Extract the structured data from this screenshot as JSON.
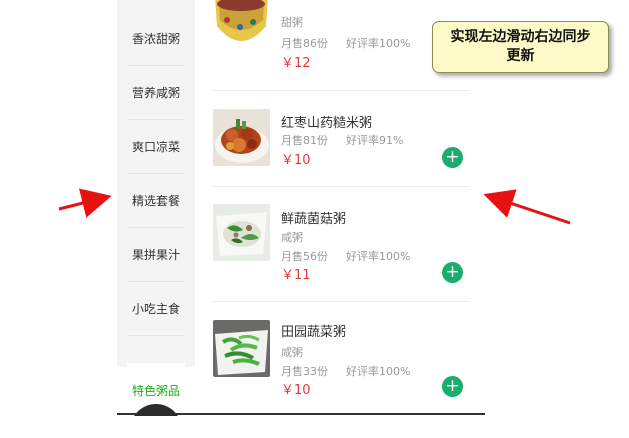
{
  "sidebar": {
    "categories": [
      "香浓甜粥",
      "营养咸粥",
      "爽口凉菜",
      "精选套餐",
      "果拼果汁",
      "小吃主食"
    ],
    "active_category": "特色粥品"
  },
  "products": [
    {
      "subtitle": "甜粥",
      "sales": "月售86份",
      "rating": "好评率100%",
      "price": "￥12"
    },
    {
      "name": "红枣山药糙米粥",
      "sales": "月售81份",
      "rating": "好评率91%",
      "price": "￥10",
      "add_icon": "plus-circle-icon"
    },
    {
      "name": "鲜蔬菌菇粥",
      "subtitle": "咸粥",
      "sales": "月售56份",
      "rating": "好评率100%",
      "price": "￥11",
      "add_icon": "plus-circle-icon"
    },
    {
      "name": "田园蔬菜粥",
      "subtitle": "咸粥",
      "sales": "月售33份",
      "rating": "好评率100%",
      "price": "￥10",
      "add_icon": "plus-circle-icon"
    }
  ],
  "annotation": {
    "text": "实现左边滑动右边同步更新"
  },
  "colors": {
    "accent": "#1aad19",
    "price": "#e4393c",
    "add_button": "#1aad6e",
    "arrow": "#e81010",
    "note_background": "#fffbc8"
  }
}
